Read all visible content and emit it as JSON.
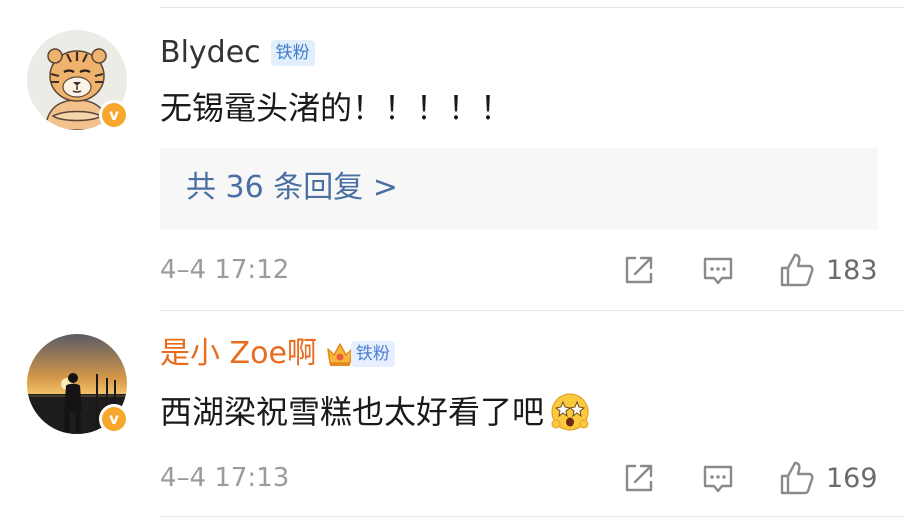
{
  "comments": [
    {
      "username": "Blydec",
      "fan_badge": "铁粉",
      "text": "无锡鼋头渚的！！！！！",
      "replies_link": "共 36 条回复 >",
      "timestamp": "4–4 17:12",
      "likes": "183",
      "avatar": "tiger-avatar",
      "verified_mark": "v"
    },
    {
      "username": "是小 Zoe啊",
      "fan_badge": "铁粉",
      "text": "西湖梁祝雪糕也太好看了吧",
      "timestamp": "4–4 17:13",
      "likes": "169",
      "avatar": "sunset-silhouette-avatar",
      "verified_mark": "v",
      "emoji": "starry-eyed-emoji"
    }
  ],
  "colors": {
    "orange_username": "#e86c1e",
    "link_blue": "#4a6fa2",
    "verified_badge": "#f7a72d",
    "fan_badge_bg": "#e2eefb",
    "fan_badge_text": "#3f7ecd"
  },
  "icons": [
    "share-icon",
    "comment-icon",
    "like-icon",
    "crown-icon",
    "verified-icon"
  ]
}
